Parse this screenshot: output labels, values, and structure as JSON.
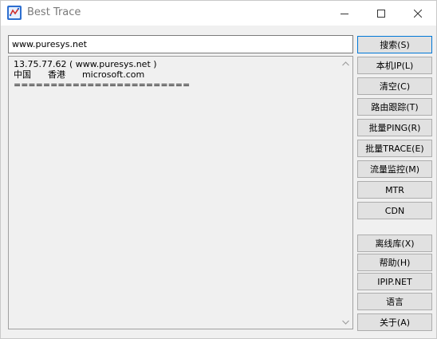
{
  "window": {
    "title": "Best Trace"
  },
  "url_input": {
    "value": "www.puresys.net"
  },
  "output": {
    "lines": [
      "13.75.77.62 ( www.puresys.net )",
      "中国      香港      microsoft.com",
      "========================"
    ]
  },
  "buttons": {
    "search": "搜索(S)",
    "local_ip": "本机IP(L)",
    "clear": "清空(C)",
    "route_trace": "路由跟踪(T)",
    "batch_ping": "批量PING(R)",
    "batch_trace": "批量TRACE(E)",
    "traffic_monitor": "流量监控(M)",
    "mtr": "MTR",
    "cdn": "CDN",
    "offline_db": "离线库(X)",
    "help": "帮助(H)",
    "ipip_net": "IPIP.NET",
    "language": "语言",
    "about": "关于(A)"
  },
  "colors": {
    "focus_border": "#0078d7",
    "window_bg": "#f0f0f0",
    "button_bg": "#e1e1e1"
  }
}
